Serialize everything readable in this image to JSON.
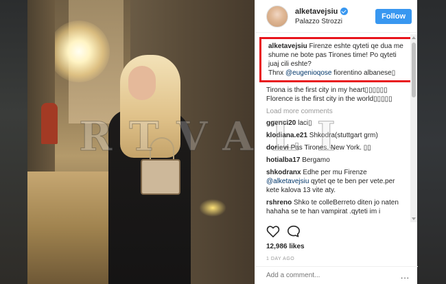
{
  "post": {
    "username": "alketavejsiu",
    "location": "Palazzo Strozzi",
    "follow_label": "Follow",
    "caption_username": "alketavejsiu",
    "caption_text": " Firenze eshte qyteti qe dua me shume ne bote pas Tirones time! Po qyteti juaj cili eshte?",
    "caption_thnx": "Thnx ",
    "caption_mention": "@eugenioqose",
    "caption_end": " fiorentino albanese▯",
    "caption_line2": "Tirona is the first city in my heart▯▯▯▯▯▯",
    "caption_line3": "Florence is the first city in the world▯▯▯▯▯",
    "load_more": "Load more comments",
    "likes": "12,986 likes",
    "time": "1 DAY AGO",
    "add_comment_placeholder": "Add a comment...",
    "more_options": "..."
  },
  "comments": [
    {
      "user": "ggenci20",
      "text": " laci▯"
    },
    {
      "user": "klodiana.e21",
      "text": " Shkodra(stuttgart grm)"
    },
    {
      "user": "dorievi",
      "text": " Pas Tirones. New York. ▯▯"
    },
    {
      "user": "hotialba17",
      "text": " Bergamo"
    },
    {
      "user": "shkodranx",
      "text": " Edhe per mu Firenze",
      "mention": "@alketavejsiu",
      "text2": " qytet qe te ben per vete.per kete kalova 13 vite aty."
    },
    {
      "user": "rshreno",
      "text": " Shko te colleBerreto diten jo naten hahaha se te han vampirat .qyteti im i"
    }
  ],
  "watermark": "RTVALI",
  "icons": [
    "heart-icon",
    "comment-icon",
    "verified-badge-icon"
  ],
  "colors": {
    "follow": "#3897f0",
    "highlight": "#e8141b",
    "mention": "#003569"
  }
}
